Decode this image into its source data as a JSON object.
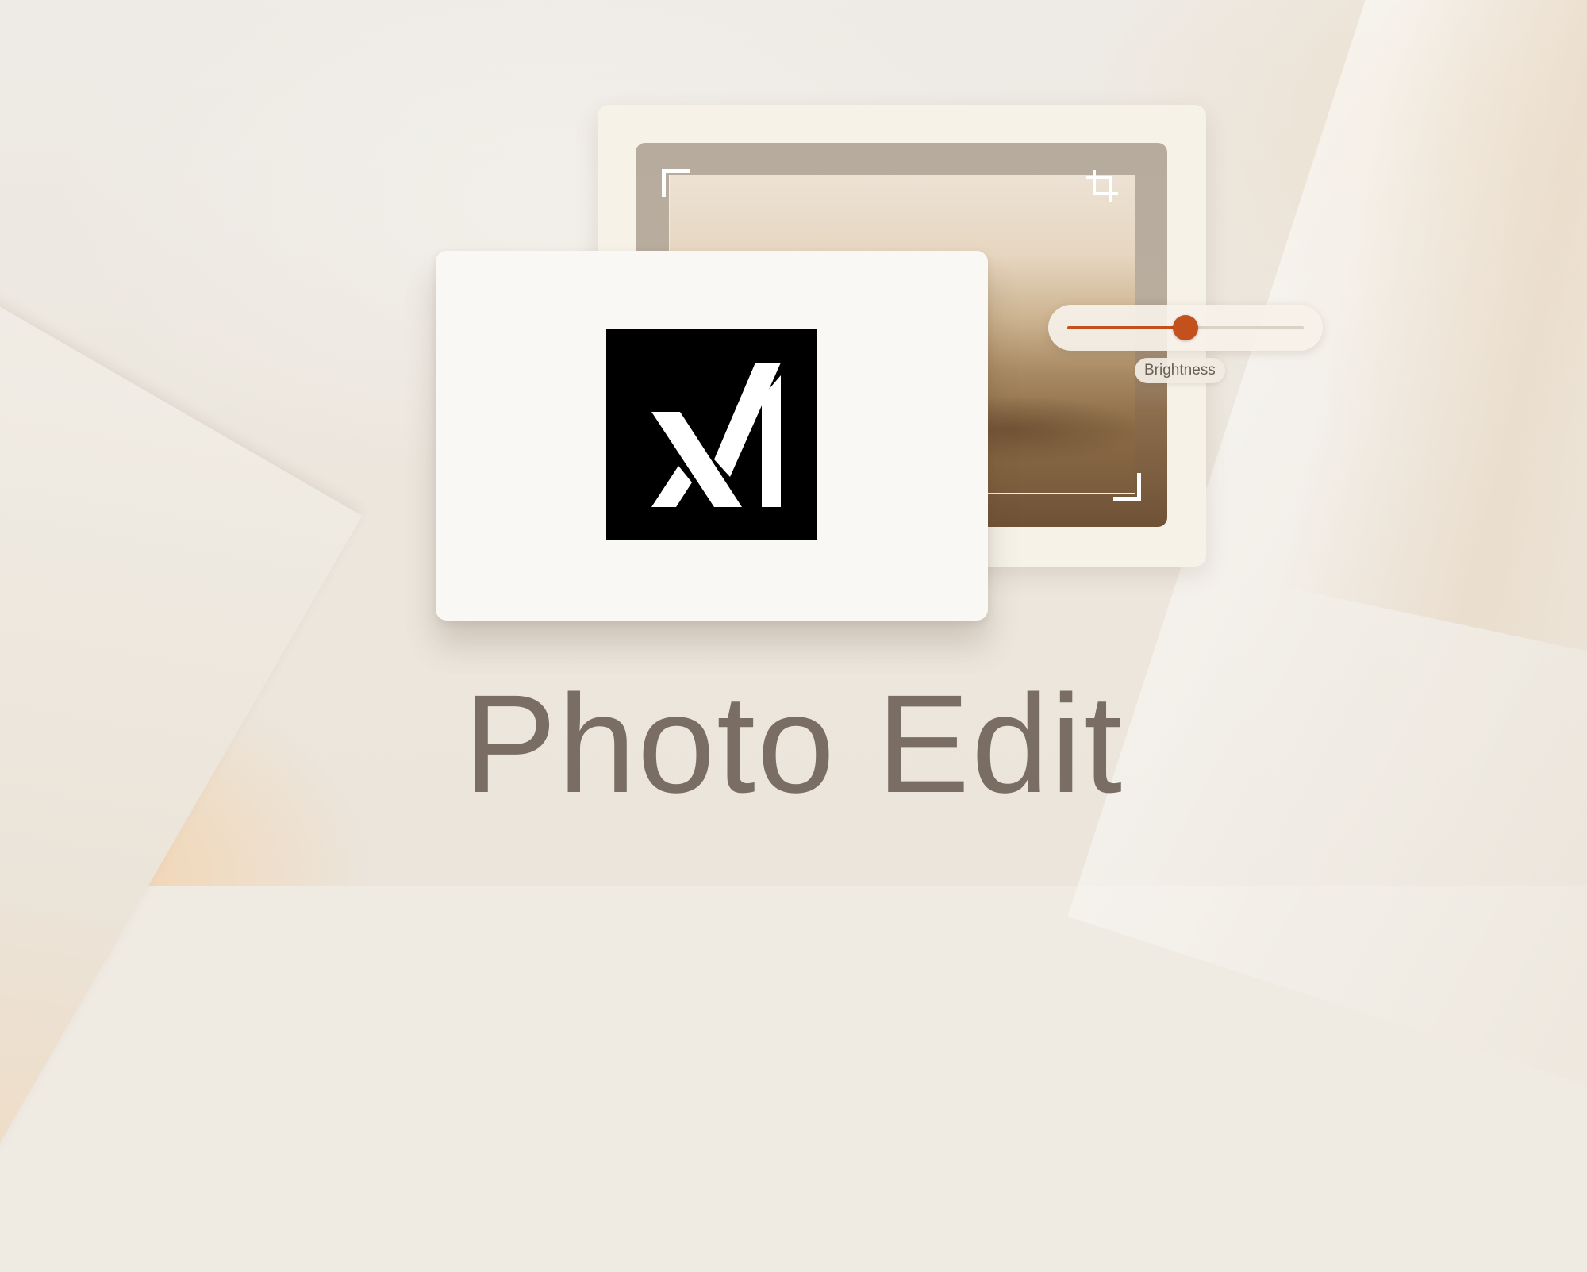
{
  "title": "Photo Edit",
  "slider": {
    "label": "Brightness",
    "value": 0.5
  },
  "logo": {
    "name": "xAI",
    "icon": "xai-logo-icon"
  },
  "colors": {
    "accent": "#c4501d",
    "title": "#7a6e64",
    "card": "#f9f8f5",
    "logo_bg": "#000000"
  }
}
